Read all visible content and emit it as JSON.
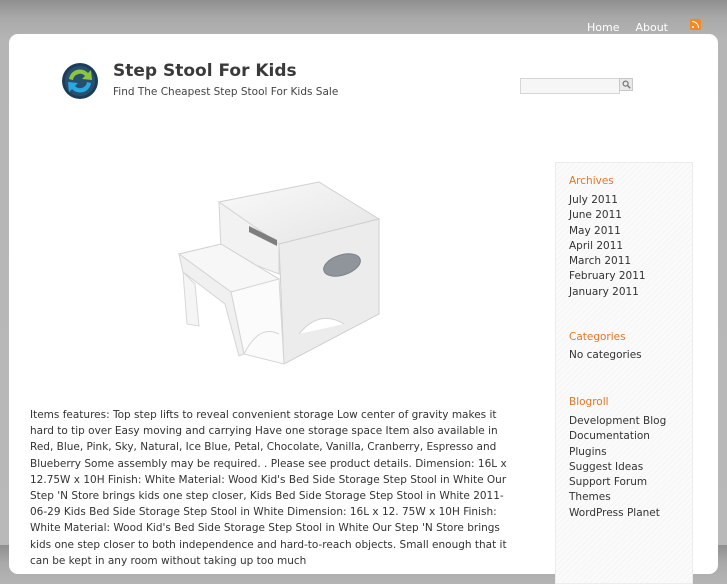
{
  "nav": {
    "home": "Home",
    "about": "About",
    "feed_icon": "rss-icon"
  },
  "header": {
    "logo_icon": "sync-logo-icon",
    "title": "Step Stool For Kids",
    "tagline": "Find The Cheapest Step Stool For Kids Sale"
  },
  "search": {
    "placeholder": "",
    "button_icon": "magnifier-icon"
  },
  "post": {
    "image": "white-two-step-storage-stool",
    "body": "Items features: Top step lifts to reveal convenient storage Low center of gravity makes it hard to tip over Easy moving and carrying Have one storage space Item also available in  Red, Blue, Pink, Sky, Natural, Ice Blue, Petal, Chocolate, Vanilla, Cranberry, Espresso and Blueberry Some assembly may be required. . Please see product details. Dimension: 16L x 12.75W x 10H Finish: White Material: Wood Kid's Bed Side Storage Step Stool in White Our Step 'N Store brings kids one step closer, Kids Bed Side Storage Step Stool in White 2011-06-29 Kids Bed Side Storage Step Stool in White Dimension: 16L x 12. 75W x 10H Finish: White Material: Wood Kid's Bed Side Storage Step Stool in White Our Step 'N Store brings kids one step closer to both independence and hard-to-reach objects. Small enough that it can be kept in any room without taking up too much"
  },
  "sidebar": {
    "archives": {
      "title": "Archives",
      "items": [
        "July 2011",
        "June 2011",
        "May 2011",
        "April 2011",
        "March 2011",
        "February 2011",
        "January 2011"
      ]
    },
    "categories": {
      "title": "Categories",
      "empty": "No categories"
    },
    "blogroll": {
      "title": "Blogroll",
      "items": [
        "Development Blog",
        "Documentation",
        "Plugins",
        "Suggest Ideas",
        "Support Forum",
        "Themes",
        "WordPress Planet"
      ]
    }
  }
}
